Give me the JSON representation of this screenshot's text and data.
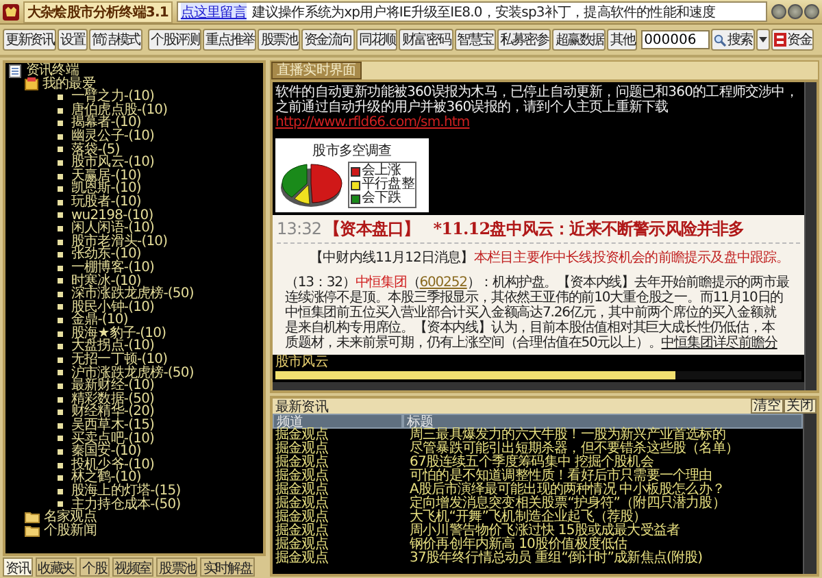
{
  "window": {
    "title": "大杂烩股市分析终端3.1",
    "message_link": "点这里留言",
    "message": "建议操作系统为xp用户将IE升级至IE8.0，安装sp3补丁，提高软件的性能和速度"
  },
  "toolbar": {
    "buttons": [
      "更新资讯",
      "设置",
      "简洁模式",
      "个股评测",
      "重点推举",
      "股票池",
      "资金流向",
      "同花顺",
      "财富密码",
      "智慧宝",
      "私募密参",
      "超赢数据",
      "其他"
    ],
    "code_input": {
      "value": "000006"
    },
    "search_button": "搜索",
    "fund_button": "资金"
  },
  "sidebar": {
    "tree": [
      {
        "label": "资讯终端",
        "kind": "root",
        "children": [
          {
            "label": "我的最爱",
            "kind": "favorites",
            "children": [
              {
                "label": "一臂之力-(10)",
                "kind": "item"
              },
              {
                "label": "唐伯虎点股-(10)",
                "kind": "item"
              },
              {
                "label": "揭幕者-(10)",
                "kind": "item"
              },
              {
                "label": "幽灵公子-(10)",
                "kind": "item"
              },
              {
                "label": "落袋-(5)",
                "kind": "item"
              },
              {
                "label": "股市风云-(10)",
                "kind": "item"
              },
              {
                "label": "天赢居-(10)",
                "kind": "item"
              },
              {
                "label": "凯恩斯-(10)",
                "kind": "item"
              },
              {
                "label": "玩股者-(10)",
                "kind": "item"
              },
              {
                "label": "wu2198-(10)",
                "kind": "item"
              },
              {
                "label": "闲人闲语-(10)",
                "kind": "item"
              },
              {
                "label": "股市老滑头-(10)",
                "kind": "item"
              },
              {
                "label": "张劲东-(10)",
                "kind": "item"
              },
              {
                "label": "一棚博客-(10)",
                "kind": "item"
              },
              {
                "label": "时寒冰-(10)",
                "kind": "item"
              },
              {
                "label": "深市涨跌龙虎榜-(50)",
                "kind": "item"
              },
              {
                "label": "股民小钟-(10)",
                "kind": "item"
              },
              {
                "label": "金鼎-(10)",
                "kind": "item"
              },
              {
                "label": "股海★豹子-(10)",
                "kind": "item"
              },
              {
                "label": "大盘拐点-(10)",
                "kind": "item"
              },
              {
                "label": "无招一丁顿-(10)",
                "kind": "item"
              },
              {
                "label": "沪市涨跌龙虎榜-(50)",
                "kind": "item"
              },
              {
                "label": "最新财经-(10)",
                "kind": "item"
              },
              {
                "label": "精彩数据-(50)",
                "kind": "item"
              },
              {
                "label": "财经精华-(20)",
                "kind": "item"
              },
              {
                "label": "吴西草木-(15)",
                "kind": "item"
              },
              {
                "label": "买卖点吧-(10)",
                "kind": "item"
              },
              {
                "label": "秦国安-(10)",
                "kind": "item"
              },
              {
                "label": "投机少爷-(10)",
                "kind": "item"
              },
              {
                "label": "林之鹤-(10)",
                "kind": "item"
              },
              {
                "label": "股海上的灯塔-(15)",
                "kind": "item"
              },
              {
                "label": "主力持仓成本-(50)",
                "kind": "item"
              }
            ]
          },
          {
            "label": "名家观点",
            "kind": "folder"
          },
          {
            "label": "个股新闻",
            "kind": "folder"
          }
        ]
      }
    ],
    "tabs": [
      {
        "label": "资讯",
        "selected": true
      },
      {
        "label": "收藏夹",
        "selected": false
      },
      {
        "label": "个股",
        "selected": false
      },
      {
        "label": "视频室",
        "selected": false
      },
      {
        "label": "股票池",
        "selected": false
      },
      {
        "label": "实时解盘",
        "selected": false
      }
    ]
  },
  "live_panel": {
    "tab": "直播实时界面",
    "notice": [
      "软件的自动更新功能被360误报为木马，已停止自动更新，问题已和360的工程师交涉中，",
      "之前通过自动升级的用户并被360误报的，请到个人主页上重新下载"
    ],
    "notice_link": "http://www.rfld66.com/sm.htm",
    "survey": {
      "title": "股市多空调查",
      "legend": [
        {
          "label": "会上涨",
          "color": "#d01818"
        },
        {
          "label": "平行盘整",
          "color": "#f0e020"
        },
        {
          "label": "会下跌",
          "color": "#1a8a1a"
        }
      ]
    },
    "headline": {
      "time": "13:32",
      "section": "【资本盘口】",
      "title": "*11.12盘中风云：近来不断警示风险并非多"
    },
    "intro": {
      "source": "【中财内线11月12日消息】",
      "text": "本栏目主要作中长线投资机会的前瞻提示及盘中跟踪。"
    },
    "article_lines": [
      [
        {
          "kind": "plain",
          "text": "（13：32）"
        },
        {
          "kind": "stock",
          "text": "中恒集团"
        },
        {
          "kind": "plain",
          "text": "（"
        },
        {
          "kind": "code",
          "text": "600252"
        },
        {
          "kind": "plain",
          "text": "）：机构护盘。【资本内线】去年开始前瞻提示的两市最"
        }
      ],
      [
        {
          "kind": "plain",
          "text": "连续涨停不是顶。本股三季报显示，其依然王亚伟的前10大重仓股之一。而11月10日的"
        }
      ],
      [
        {
          "kind": "plain",
          "text": "中恒集团前五位买入营业部合计买入金额高达7.26亿元，其中前两个席位的买入金额就"
        }
      ],
      [
        {
          "kind": "plain",
          "text": "是来自机构专用席位。【资本内线】认为，目前本股估值相对其巨大成长性仍低估，本"
        }
      ],
      [
        {
          "kind": "plain",
          "text": "质题材，未来前景可期，仍有上涨空间（合理估值在50元以上）。"
        },
        {
          "kind": "link",
          "text": "中恒集团详尽前瞻分"
        }
      ]
    ],
    "ticker": {
      "label": "股市风云",
      "level": 0.76
    }
  },
  "news": {
    "title": "最新资讯",
    "buttons": [
      "清空",
      "关闭"
    ],
    "columns": [
      "频道",
      "标题"
    ],
    "rows": [
      {
        "channel": "掘金观点",
        "title": "周三最具爆发力的六大牛股！一股为新兴产业首选标的"
      },
      {
        "channel": "掘金观点",
        "title": "尽管暴跌可能引出短期杀器，但不要错杀这些股（名单）"
      },
      {
        "channel": "掘金观点",
        "title": "67股连续五个季度筹码集中 挖掘个股机会"
      },
      {
        "channel": "掘金观点",
        "title": "可怕的是不知道调整性质！看好后市只需要一个理由"
      },
      {
        "channel": "掘金观点",
        "title": "A股后市演绎最可能出现的两种情况 中小板股怎么办？"
      },
      {
        "channel": "掘金观点",
        "title": "定向增发消息突变相关股票“护身符”（附四只潜力股）"
      },
      {
        "channel": "掘金观点",
        "title": "大飞机“开舞”飞机制造企业起飞（荐股）"
      },
      {
        "channel": "掘金观点",
        "title": "周小川警告物价飞涨过快 15股或成最大受益者"
      },
      {
        "channel": "掘金观点",
        "title": "钢价再创年内新高 10股价值极度低估"
      },
      {
        "channel": "掘金观点",
        "title": "37股年终行情总动员 重组“倒计时”成新焦点(附股)"
      }
    ]
  }
}
